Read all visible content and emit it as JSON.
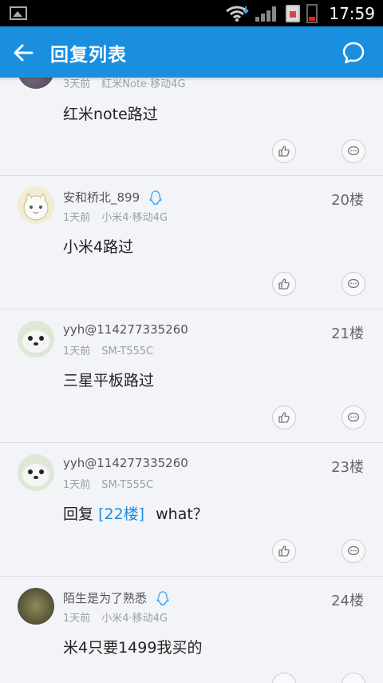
{
  "status_bar": {
    "time": "17:59"
  },
  "app_bar": {
    "title": "回复列表"
  },
  "replies": [
    {
      "meta_time": "3天前",
      "device": "红米Note·移动4G",
      "content": "红米note路过"
    },
    {
      "username": "安和桥北_899",
      "meta_time": "1天前",
      "device": "小米4·移动4G",
      "floor": "20楼",
      "content": "小米4路过"
    },
    {
      "username": "yyh@114277335260",
      "meta_time": "1天前",
      "device": "SM-T555C",
      "floor": "21楼",
      "content": "三星平板路过"
    },
    {
      "username": "yyh@114277335260",
      "meta_time": "1天前",
      "device": "SM-T555C",
      "floor": "23楼",
      "content_prefix": "回复",
      "content_ref": "[22楼]",
      "content": "what？"
    },
    {
      "username": "陌生是为了熟悉",
      "meta_time": "1天前",
      "device": "小米4·移动4G",
      "floor": "24楼",
      "content": "米4只要1499我买的"
    }
  ],
  "colors": {
    "accent": "#1a8fe0",
    "background": "#f2f4f7"
  }
}
